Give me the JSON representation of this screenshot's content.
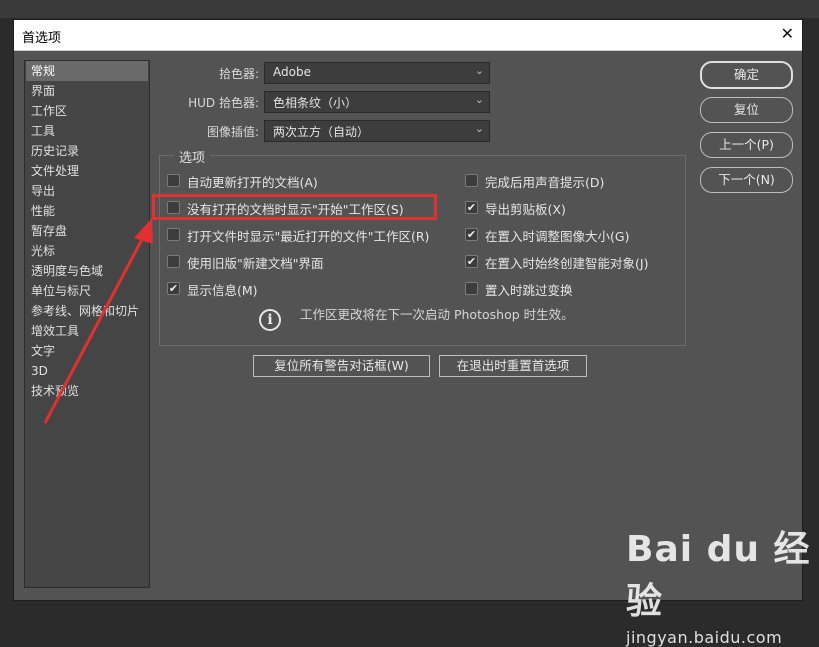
{
  "window": {
    "title": "首选项",
    "close_glyph": "✕"
  },
  "sidebar": {
    "items": [
      {
        "label": "常规",
        "selected": true
      },
      {
        "label": "界面"
      },
      {
        "label": "工作区"
      },
      {
        "label": "工具"
      },
      {
        "label": "历史记录"
      },
      {
        "label": "文件处理"
      },
      {
        "label": "导出"
      },
      {
        "label": "性能"
      },
      {
        "label": "暂存盘"
      },
      {
        "label": "光标"
      },
      {
        "label": "透明度与色域"
      },
      {
        "label": "单位与标尺"
      },
      {
        "label": "参考线、网格和切片"
      },
      {
        "label": "增效工具"
      },
      {
        "label": "文字"
      },
      {
        "label": "3D"
      },
      {
        "label": "技术预览"
      }
    ]
  },
  "general": {
    "color_picker": {
      "label": "拾色器:",
      "value": "Adobe"
    },
    "hud_color_picker": {
      "label": "HUD 拾色器:",
      "value": "色相条纹（小）"
    },
    "image_interpolation": {
      "label": "图像插值:",
      "value": "两次立方（自动）"
    }
  },
  "options": {
    "title": "选项",
    "left": [
      {
        "label": "自动更新打开的文档(A)",
        "checked": false
      },
      {
        "label": "没有打开的文档时显示\"开始\"工作区(S)",
        "checked": false,
        "highlighted": true
      },
      {
        "label": "打开文件时显示\"最近打开的文件\"工作区(R)",
        "checked": false
      },
      {
        "label": "使用旧版\"新建文档\"界面",
        "checked": false
      },
      {
        "label": "显示信息(M)",
        "checked": true
      }
    ],
    "right": [
      {
        "label": "完成后用声音提示(D)",
        "checked": false
      },
      {
        "label": "导出剪贴板(X)",
        "checked": true
      },
      {
        "label": "在置入时调整图像大小(G)",
        "checked": true
      },
      {
        "label": "在置入时始终创建智能对象(J)",
        "checked": true
      },
      {
        "label": "置入时跳过变换",
        "checked": false
      }
    ],
    "info_text": "工作区更改将在下一次启动 Photoshop 时生效。",
    "info_glyph": "i"
  },
  "bottom_buttons": {
    "reset_warnings": "复位所有警告对话框(W)",
    "reset_on_quit": "在退出时重置首选项"
  },
  "side_buttons": {
    "ok": "确定",
    "reset": "复位",
    "prev": "上一个(P)",
    "next": "下一个(N)"
  },
  "watermark": {
    "logo": "Bai du 经验",
    "url": "jingyan.baidu.com"
  },
  "colors": {
    "dialog_bg": "#535353",
    "highlight": "#e0302f",
    "arrow": "#e0302f"
  }
}
